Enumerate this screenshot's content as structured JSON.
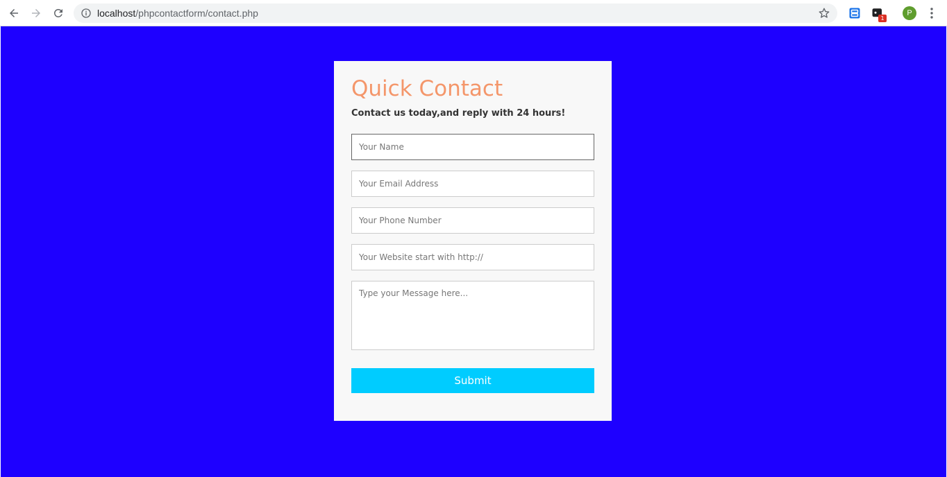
{
  "browser": {
    "url_host": "localhost",
    "url_path": "/phpcontactform/contact.php",
    "avatar_letter": "P",
    "extension_badge": "1",
    "icons": [
      "back-icon",
      "forward-icon",
      "reload-icon",
      "info-icon",
      "star-icon",
      "extension-icon",
      "extension-icon",
      "avatar",
      "more-menu-icon"
    ]
  },
  "page": {
    "background_color": "#1e00ff"
  },
  "form": {
    "title": "Quick Contact",
    "subtitle": "Contact us today,and reply with 24 hours!",
    "title_color": "#f4966a",
    "name_placeholder": "Your Name",
    "email_placeholder": "Your Email Address",
    "phone_placeholder": "Your Phone Number",
    "website_placeholder": "Your Website start with http://",
    "message_placeholder": "Type your Message here...",
    "submit_label": "Submit",
    "submit_color": "#00ccff"
  }
}
